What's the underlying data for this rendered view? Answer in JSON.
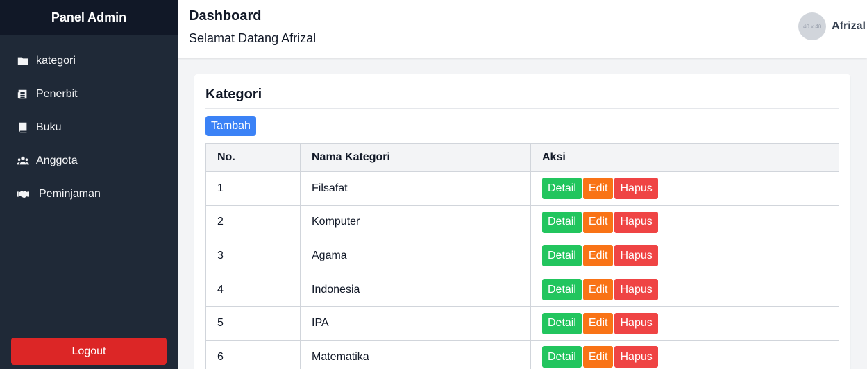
{
  "sidebar": {
    "title": "Panel Admin",
    "items": [
      {
        "label": "kategori",
        "icon": "folder-icon"
      },
      {
        "label": "Penerbit",
        "icon": "newspaper-icon"
      },
      {
        "label": "Buku",
        "icon": "book-icon"
      },
      {
        "label": "Anggota",
        "icon": "users-icon"
      },
      {
        "label": "Peminjaman",
        "icon": "handshake-icon"
      }
    ],
    "logout_label": "Logout"
  },
  "header": {
    "title": "Dashboard",
    "subtitle": "Selamat Datang Afrizal",
    "avatar_text": "40 x 40",
    "user_name": "Afrizal"
  },
  "card": {
    "title": "Kategori",
    "add_label": "Tambah",
    "columns": [
      "No.",
      "Nama Kategori",
      "Aksi"
    ],
    "rows": [
      {
        "no": "1",
        "name": "Filsafat"
      },
      {
        "no": "2",
        "name": "Komputer"
      },
      {
        "no": "3",
        "name": "Agama"
      },
      {
        "no": "4",
        "name": "Indonesia"
      },
      {
        "no": "5",
        "name": "IPA"
      },
      {
        "no": "6",
        "name": "Matematika"
      }
    ],
    "actions": {
      "detail": "Detail",
      "edit": "Edit",
      "hapus": "Hapus"
    }
  },
  "colors": {
    "sidebar_bg": "#1f2937",
    "sidebar_header_bg": "#111827",
    "logout": "#dc2626",
    "primary": "#3b82f6",
    "detail": "#22c55e",
    "edit": "#f97316",
    "hapus": "#ef4444"
  }
}
